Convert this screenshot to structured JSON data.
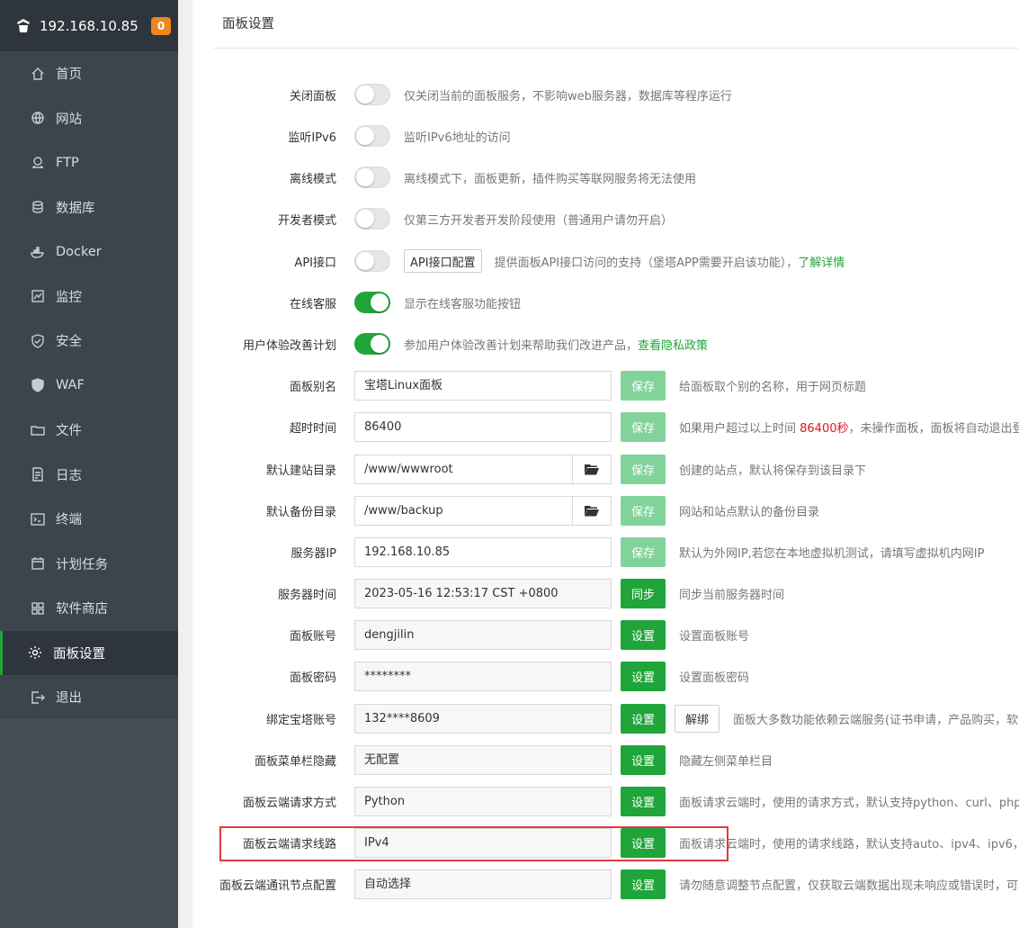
{
  "sidebar": {
    "server_ip": "192.168.10.85",
    "badge": "0",
    "items": [
      {
        "label": "首页",
        "icon": "home-icon"
      },
      {
        "label": "网站",
        "icon": "globe-icon"
      },
      {
        "label": "FTP",
        "icon": "ftp-icon"
      },
      {
        "label": "数据库",
        "icon": "database-icon"
      },
      {
        "label": "Docker",
        "icon": "docker-icon"
      },
      {
        "label": "监控",
        "icon": "monitor-icon"
      },
      {
        "label": "安全",
        "icon": "shield-icon"
      },
      {
        "label": "WAF",
        "icon": "waf-shield-icon"
      },
      {
        "label": "文件",
        "icon": "folder-icon"
      },
      {
        "label": "日志",
        "icon": "log-icon"
      },
      {
        "label": "终端",
        "icon": "terminal-icon"
      },
      {
        "label": "计划任务",
        "icon": "calendar-icon"
      },
      {
        "label": "软件商店",
        "icon": "grid-icon"
      },
      {
        "label": "面板设置",
        "icon": "gear-icon",
        "active": true
      },
      {
        "label": "退出",
        "icon": "logout-icon"
      }
    ]
  },
  "main": {
    "title": "面板设置",
    "toggles": [
      {
        "label": "关闭面板",
        "on": false,
        "desc": "仅关闭当前的面板服务，不影响web服务器，数据库等程序运行"
      },
      {
        "label": "监听IPv6",
        "on": false,
        "desc": "监听IPv6地址的访问"
      },
      {
        "label": "离线模式",
        "on": false,
        "desc": "离线模式下，面板更新，插件购买等联网服务将无法使用"
      },
      {
        "label": "开发者模式",
        "on": false,
        "desc": "仅第三方开发者开发阶段使用（普通用户请勿开启）"
      },
      {
        "label": "API接口",
        "on": false,
        "button": "API接口配置",
        "desc": "提供面板API接口访问的支持（堡塔APP需要开启该功能），",
        "link": "了解详情"
      },
      {
        "label": "在线客服",
        "on": true,
        "desc": "显示在线客服功能按钮"
      },
      {
        "label": "用户体验改善计划",
        "on": true,
        "desc": "参加用户体验改善计划来帮助我们改进产品，",
        "link": "查看隐私政策"
      }
    ],
    "fields": [
      {
        "label": "面板别名",
        "value": "宝塔Linux面板",
        "button": "保存",
        "desc": "给面板取个别的名称，用于网页标题"
      },
      {
        "label": "超时时间",
        "value": "86400",
        "button": "保存",
        "desc_pre": "如果用户超过以上时间 ",
        "desc_red": "86400秒",
        "desc_post": "，未操作面板，面板将自动退出登录"
      },
      {
        "label": "默认建站目录",
        "value": "/www/wwwroot",
        "button": "保存",
        "desc": "创建的站点，默认将保存到该目录下"
      },
      {
        "label": "默认备份目录",
        "value": "/www/backup",
        "button": "保存",
        "desc": "网站和站点默认的备份目录"
      },
      {
        "label": "服务器IP",
        "value": "192.168.10.85",
        "button": "保存",
        "desc": "默认为外网IP,若您在本地虚拟机测试，请填写虚拟机内网IP"
      },
      {
        "label": "服务器时间",
        "value": "2023-05-16 12:53:17 CST +0800",
        "button": "同步",
        "desc": "同步当前服务器时间"
      },
      {
        "label": "面板账号",
        "value": "dengjilin",
        "button": "设置",
        "desc": "设置面板账号"
      },
      {
        "label": "面板密码",
        "value": "********",
        "button": "设置",
        "desc": "设置面板密码"
      },
      {
        "label": "绑定宝塔账号",
        "value": "132****8609",
        "button": "设置",
        "button2": "解绑",
        "desc": "面板大多数功能依赖云端服务(证书申请，产品购买，软件安装等)"
      },
      {
        "label": "面板菜单栏隐藏",
        "value": "无配置",
        "button": "设置",
        "desc": "隐藏左侧菜单栏目"
      },
      {
        "label": "面板云端请求方式",
        "value": "Python",
        "button": "设置",
        "desc": "面板请求云端时，使用的请求方式，默认支持python、curl、php"
      },
      {
        "label": "面板云端请求线路",
        "value": "IPv4",
        "button": "设置",
        "desc": "面板请求云端时，使用的请求线路，默认支持auto、ipv4、ipv6，"
      },
      {
        "label": "面板云端通讯节点配置",
        "value": "自动选择",
        "button": "设置",
        "desc": "请勿随意调整节点配置，仅获取云端数据出现未响应或错误时，可"
      }
    ]
  }
}
